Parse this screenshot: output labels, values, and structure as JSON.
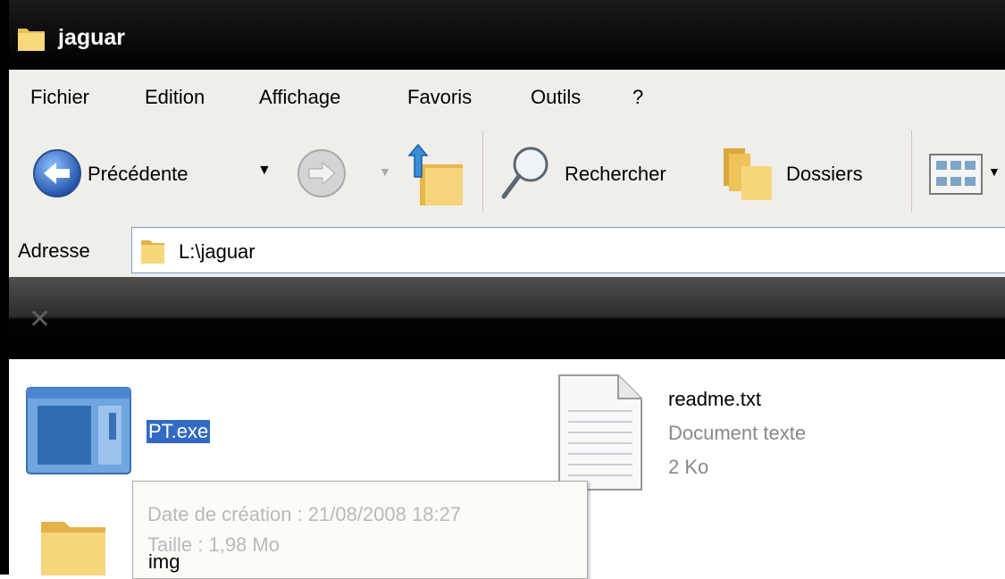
{
  "window": {
    "title": "jaguar"
  },
  "menu": {
    "items": [
      "Fichier",
      "Edition",
      "Affichage",
      "Favoris",
      "Outils",
      "?"
    ]
  },
  "toolbar": {
    "back_label": "Précédente",
    "search_label": "Rechercher",
    "folders_label": "Dossiers"
  },
  "address": {
    "label": "Adresse",
    "value": "L:\\jaguar"
  },
  "files": [
    {
      "name": "PT.exe",
      "icon": "application-icon",
      "selected": true
    },
    {
      "name": "readme.txt",
      "type": "Document texte",
      "size": "2 Ko",
      "icon": "text-document-icon"
    },
    {
      "name": "img",
      "icon": "folder-icon"
    }
  ],
  "tooltip": {
    "created": "Date de création : 21/08/2008 18:27",
    "size": "Taille : 1,98 Mo"
  },
  "colors": {
    "selection": "#316ac5",
    "titlebar": "#000000",
    "chrome": "#efeeea"
  }
}
